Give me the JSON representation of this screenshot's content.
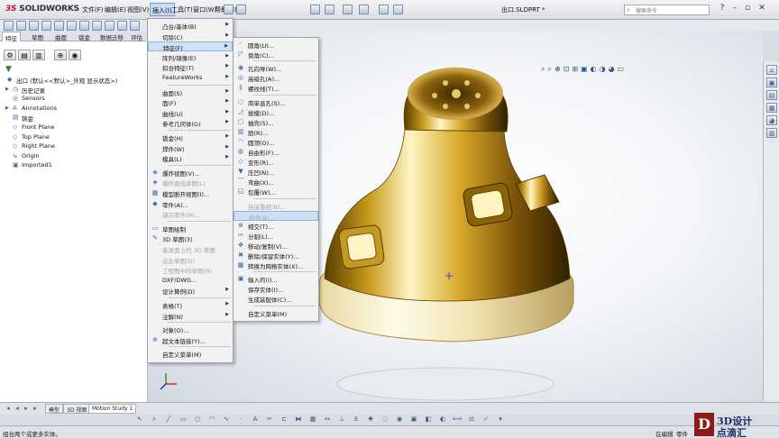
{
  "app": {
    "logo_ds": "3S",
    "logo_text": "SOLIDWORKS",
    "file_name": "出口.SLDPRT *",
    "search_placeholder": "搜索命令"
  },
  "menubar": [
    {
      "label": "文件(F)"
    },
    {
      "label": "编辑(E)"
    },
    {
      "label": "视图(V)"
    },
    {
      "label": "插入(I)",
      "active": true
    },
    {
      "label": "工具(T)"
    },
    {
      "label": "窗口(W)"
    },
    {
      "label": "帮助(H)"
    }
  ],
  "command_tabs": [
    "特征",
    "草图",
    "曲面",
    "钣金",
    "数据迁移",
    "评估"
  ],
  "feature_manager": {
    "tree": [
      {
        "label": "出口 (默认<<默认>_外观 显示状态>)",
        "icon": "part-icon",
        "arrow": ""
      },
      {
        "label": "历史记录",
        "icon": "history-icon",
        "arrow": "▶"
      },
      {
        "label": "Sensors",
        "icon": "sensor-icon",
        "arrow": ""
      },
      {
        "label": "Annotations",
        "icon": "annotation-icon",
        "arrow": "▶"
      },
      {
        "label": "铸金",
        "icon": "material-icon",
        "arrow": ""
      },
      {
        "label": "Front Plane",
        "icon": "plane-icon",
        "arrow": ""
      },
      {
        "label": "Top Plane",
        "icon": "plane-icon",
        "arrow": ""
      },
      {
        "label": "Right Plane",
        "icon": "plane-icon",
        "arrow": ""
      },
      {
        "label": "Origin",
        "icon": "origin-icon",
        "arrow": ""
      },
      {
        "label": "Imported1",
        "icon": "imported-body-icon",
        "arrow": ""
      }
    ]
  },
  "insert_menu": [
    {
      "label": "凸台/基体(B)",
      "sub": true,
      "icon": ""
    },
    {
      "label": "切除(C)",
      "sub": true,
      "icon": ""
    },
    {
      "label": "特征(F)",
      "sub": true,
      "icon": "",
      "highlight": true
    },
    {
      "label": "阵列/镜像(E)",
      "sub": true,
      "icon": ""
    },
    {
      "label": "扣合特征(T)",
      "sub": true,
      "icon": ""
    },
    {
      "label": "FeatureWorks",
      "sub": true,
      "icon": ""
    },
    {
      "label": "曲面(S)",
      "sub": true,
      "icon": "",
      "sep_before": true
    },
    {
      "label": "面(F)",
      "sub": true,
      "icon": ""
    },
    {
      "label": "曲线(U)",
      "sub": true,
      "icon": ""
    },
    {
      "label": "参考几何体(G)",
      "sub": true,
      "icon": ""
    },
    {
      "label": "钣金(H)",
      "sub": true,
      "icon": "",
      "sep_before": true
    },
    {
      "label": "焊件(W)",
      "sub": true,
      "icon": ""
    },
    {
      "label": "模具(L)",
      "sub": true,
      "icon": ""
    },
    {
      "label": "爆炸视图(V)...",
      "icon": "◈",
      "sep_before": true
    },
    {
      "label": "爆炸直线草图(L)",
      "icon": "◈",
      "disabled": true
    },
    {
      "label": "模型断开视图(I)...",
      "icon": "▦"
    },
    {
      "label": "零件(A)...",
      "icon": "◆"
    },
    {
      "label": "镜向零件(M)...",
      "icon": "",
      "disabled": true
    },
    {
      "label": "草图绘制",
      "icon": "▭",
      "sep_before": true
    },
    {
      "label": "3D 草图(3)",
      "icon": "✎"
    },
    {
      "label": "基准面上的 3D 草图",
      "icon": "",
      "disabled": true
    },
    {
      "label": "派生草图(D)",
      "icon": "",
      "disabled": true
    },
    {
      "label": "工程图中的草图(R)",
      "icon": "",
      "disabled": true
    },
    {
      "label": "DXF/DWG...",
      "icon": ""
    },
    {
      "label": "设计算例(D)",
      "sub": true,
      "icon": ""
    },
    {
      "label": "表格(T)",
      "sub": true,
      "icon": "",
      "sep_before": true
    },
    {
      "label": "注解(N)",
      "sub": true,
      "icon": ""
    },
    {
      "label": "对象(O)...",
      "icon": "",
      "sep_before": true
    },
    {
      "label": "超文本链接(Y)...",
      "icon": "⊕"
    },
    {
      "label": "自定义菜单(M)",
      "icon": "",
      "sep_before": true
    }
  ],
  "features_submenu": [
    {
      "label": "圆角(U)...",
      "icon": "◜"
    },
    {
      "label": "倒角(C)...",
      "icon": "◸"
    },
    {
      "label": "孔向导(W)...",
      "icon": "◉",
      "sep_before": true
    },
    {
      "label": "高级孔(A)...",
      "icon": "◎"
    },
    {
      "label": "螺纹线(T)...",
      "icon": "§"
    },
    {
      "label": "简单直孔(S)...",
      "icon": "○",
      "sep_before": true
    },
    {
      "label": "拔模(D)...",
      "icon": "◿"
    },
    {
      "label": "抽壳(S)...",
      "icon": "▢"
    },
    {
      "label": "肋(R)...",
      "icon": "▥"
    },
    {
      "label": "圆顶(O)...",
      "icon": "◠"
    },
    {
      "label": "自由形(F)...",
      "icon": "◍"
    },
    {
      "label": "变形(R)...",
      "icon": "◇"
    },
    {
      "label": "压凹(N)...",
      "icon": "▼"
    },
    {
      "label": "弯曲(X)...",
      "icon": "⌒"
    },
    {
      "label": "包覆(W)...",
      "icon": "◱"
    },
    {
      "label": "连接重组(B)...",
      "icon": "",
      "disabled": true,
      "sep_before": true
    },
    {
      "label": "组合(B)...",
      "icon": "",
      "disabled": true,
      "highlight": true
    },
    {
      "label": "相交(T)...",
      "icon": "⊗"
    },
    {
      "label": "分割(L)...",
      "icon": "✂"
    },
    {
      "label": "移动/复制(V)...",
      "icon": "✥"
    },
    {
      "label": "删除/保留实体(Y)...",
      "icon": "✖"
    },
    {
      "label": "转换为网格实体(X)...",
      "icon": "▩"
    },
    {
      "label": "输入的(I)...",
      "icon": "▣",
      "sep_before": true
    },
    {
      "label": "保存实体(I)...",
      "icon": ""
    },
    {
      "label": "生成装配体(C)...",
      "icon": ""
    },
    {
      "label": "自定义菜单(M)",
      "icon": "",
      "sep_before": true
    }
  ],
  "bottom_tabs": [
    {
      "label": "模型",
      "active": false
    },
    {
      "label": "3D 视图",
      "active": false
    },
    {
      "label": "Motion Study 1",
      "active": true
    }
  ],
  "status": {
    "message": "组合两个或更多实体。",
    "mode": "在编辑",
    "part_label": "零件"
  },
  "watermark": {
    "mark": "D",
    "line1": "3D设计",
    "line2": "点滴汇"
  }
}
